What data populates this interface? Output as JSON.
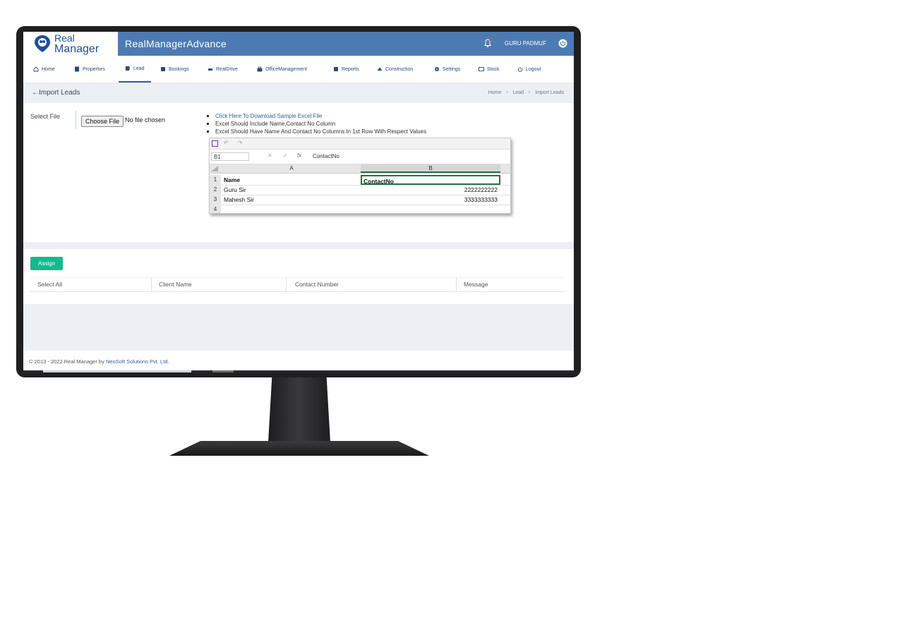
{
  "brand": {
    "logo_line1": "Real",
    "logo_line2": "Manager",
    "app_title": "RealManagerAdvance"
  },
  "header": {
    "username": "GURU PADMUF"
  },
  "nav": {
    "items": [
      {
        "label": "Home",
        "icon": "home-icon"
      },
      {
        "label": "Properties",
        "icon": "building-icon"
      },
      {
        "label": "Lead",
        "icon": "lead-icon",
        "active": true
      },
      {
        "label": "Bookings",
        "icon": "bookmark-icon"
      },
      {
        "label": "RealDrive",
        "icon": "car-icon"
      },
      {
        "label": "OfficeManagement",
        "icon": "briefcase-icon"
      },
      {
        "label": "Reports",
        "icon": "report-icon"
      },
      {
        "label": "Construction",
        "icon": "construction-icon"
      },
      {
        "label": "Settings",
        "icon": "settings-icon"
      },
      {
        "label": "Stock",
        "icon": "stock-icon"
      },
      {
        "label": "Logout",
        "icon": "power-icon"
      }
    ]
  },
  "page": {
    "back_label": "Import Leads",
    "breadcrumb": [
      "Home",
      "Lead",
      "Import Leads"
    ]
  },
  "upload": {
    "label": "Select File",
    "button_label": "Choose File",
    "status": "No file chosen",
    "instructions": [
      "Click Here To Download Sample Excel File",
      "Excel Should Include Name,Contact No Column",
      "Excel Should Have Name And Contact No Columns In 1st Row With Respect Values"
    ]
  },
  "excel_sample": {
    "namebox": "B1",
    "formula": "ContactNo",
    "col_a": "A",
    "col_b": "B",
    "rows": [
      {
        "n": "1",
        "a": "Name",
        "b": "ContactNo",
        "header": true
      },
      {
        "n": "2",
        "a": "Guru Sir",
        "b": "2222222222"
      },
      {
        "n": "3",
        "a": "Mahesh Sir",
        "b": "3333333333"
      },
      {
        "n": "4",
        "a": "",
        "b": ""
      }
    ]
  },
  "table": {
    "assign_label": "Assign",
    "columns": [
      "Select All",
      "Client Name",
      "Contact Number",
      "Message"
    ]
  },
  "footer": {
    "text": "© 2013 - 2022 Real Manager by ",
    "company": "NeoSoft Solutions Pvt. Ltd."
  },
  "colors": {
    "header": "#4c7bb4",
    "accent": "#17b88f",
    "link": "#2f5f9c"
  }
}
